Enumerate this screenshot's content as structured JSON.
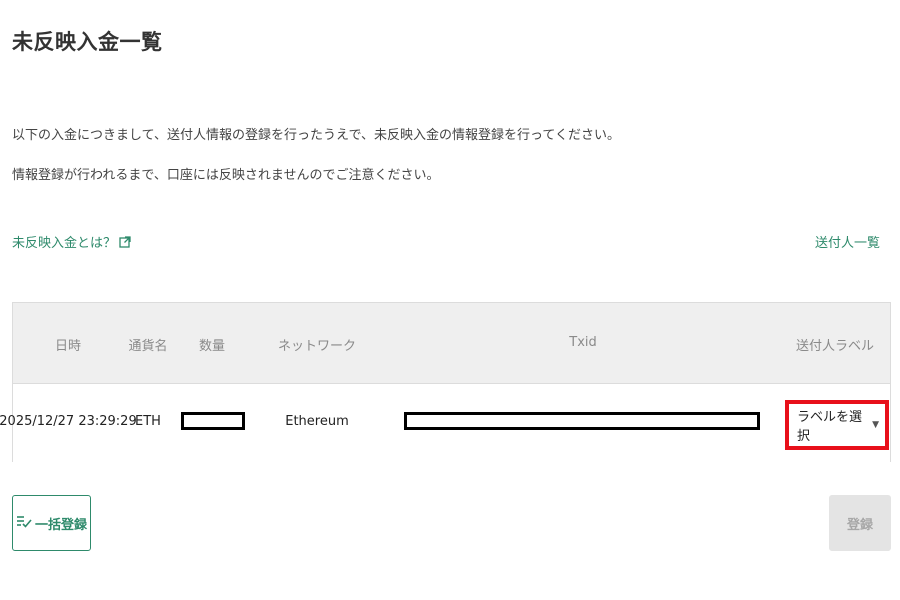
{
  "page_title": "未反映入金一覧",
  "description": {
    "line1": "以下の入金につきまして、送付人情報の登録を行ったうえで、未反映入金の情報登録を行ってください。",
    "line2": "情報登録が行われるまで、口座には反映されませんのでご注意ください。"
  },
  "links": {
    "what_is": "未反映入金とは？",
    "sender_list": "送付人一覧"
  },
  "table": {
    "headers": {
      "datetime": "日時",
      "currency": "通貨名",
      "quantity": "数量",
      "network": "ネットワーク",
      "txid": "Txid",
      "sender_label": "送付人ラベル"
    },
    "rows": [
      {
        "datetime": "2025/12/27 23:29:29",
        "currency": "ETH",
        "network": "Ethereum",
        "sender_label_select": "ラベルを選択"
      }
    ]
  },
  "buttons": {
    "bulk_register": "一括登録",
    "register": "登録"
  },
  "colors": {
    "accent": "#2e8a6b",
    "highlight": "#e8101a",
    "disabled_bg": "#e4e4e4"
  },
  "icons": {
    "external_link": "external-link-icon",
    "bulk_list": "list-check-icon",
    "dropdown": "caret-down-icon"
  }
}
